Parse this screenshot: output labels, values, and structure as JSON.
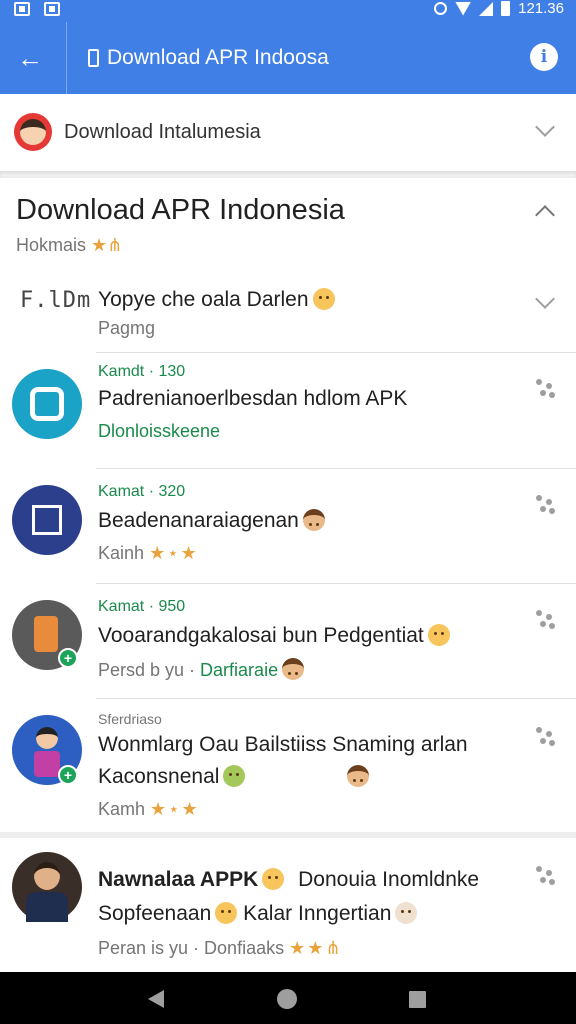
{
  "status_bar": {
    "time": "121.36"
  },
  "app_bar": {
    "title": "Download APR Indoosa"
  },
  "account": {
    "name": "Download Intalumesia"
  },
  "section": {
    "title": "Download APR Indonesia",
    "subtitle": "Hokmais",
    "subtitle_stars": "★⋔"
  },
  "items": [
    {
      "logo": "F.lDm",
      "title": "Yopye che oala Darlen",
      "sub": "Pagmg"
    },
    {
      "meta": "Kamdt · 130",
      "title": "Padrenianoerlbesdan hdlom APK",
      "sub": "Dlonloisskeene"
    },
    {
      "meta": "Kamat · 320",
      "title": "Beadenanaraiagenan",
      "sub": "Kainh",
      "stars": "★⋆★"
    },
    {
      "meta": "Kamat · 950",
      "title": "Vooarandgakalosai bun Pedgentiat",
      "sub": "Persd b yu",
      "sub_link": "Darfiaraie"
    },
    {
      "meta": "Sferdriaso",
      "title": "Wonmlarg Oau Bailstiiss Snaming arlan",
      "title2": "Kaconsnenal",
      "sub": "Kamh",
      "stars": "★⋆★"
    },
    {
      "title_bold": "Nawnalaa APPK",
      "title_rest": "Donouia Inomldnke",
      "title2": "Sopfeenaan",
      "title2_rest": "Kalar Inngertian",
      "sub": "Peran is yu",
      "sub_link": "Donfiaaks",
      "stars": "★★⋔"
    }
  ]
}
